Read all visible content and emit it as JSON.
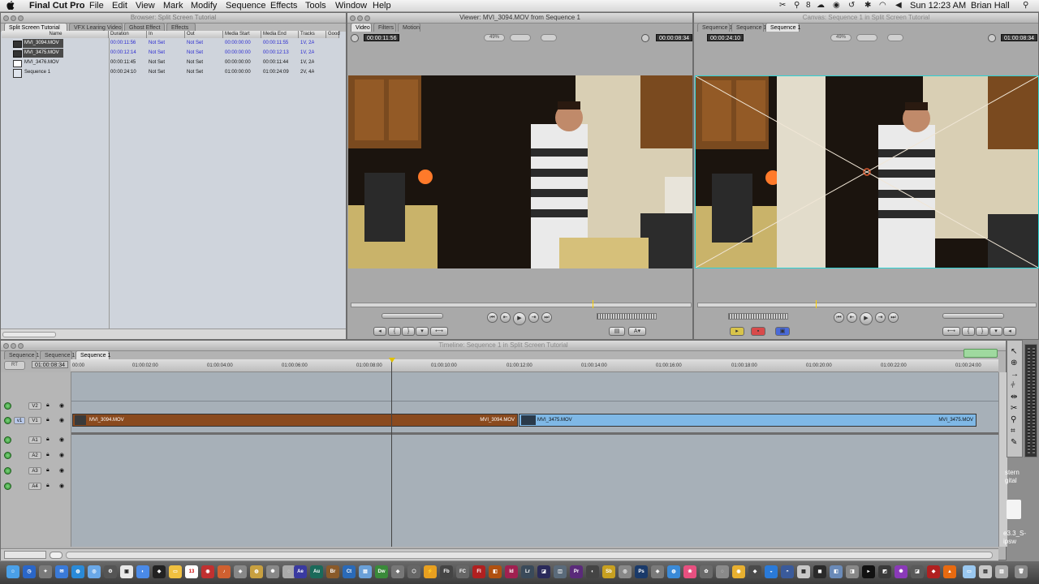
{
  "menubar": {
    "apple": "",
    "app_name": "Final Cut Pro",
    "items": [
      "File",
      "Edit",
      "View",
      "Mark",
      "Modify",
      "Sequence",
      "Effects",
      "Tools",
      "Window",
      "Help"
    ],
    "tray_badge": "8",
    "clock": "Sun 12:23 AM",
    "user": "Brian Hall"
  },
  "browser": {
    "title": "Browser: Split Screen Tutorial",
    "tabs": [
      "Split Screen Tutorial",
      "VFX Learing Video",
      "Ghost Effect",
      "Effects"
    ],
    "columns": [
      "Name",
      "Duration",
      "In",
      "Out",
      "Media Start",
      "Media End",
      "Tracks",
      "Good"
    ],
    "rows": [
      {
        "name": "MVI_3094.MOV",
        "duration": "00:00:11:56",
        "in": "Not Set",
        "out": "Not Set",
        "media_start": "00:00:00:00",
        "media_end": "00:00:11:55",
        "tracks": "1V, 2A"
      },
      {
        "name": "MVI_3475.MOV",
        "duration": "00:00:12:14",
        "in": "Not Set",
        "out": "Not Set",
        "media_start": "00:00:00:00",
        "media_end": "00:00:12:13",
        "tracks": "1V, 2A"
      },
      {
        "name": "MVI_3476.MOV",
        "duration": "00:00:11:45",
        "in": "Not Set",
        "out": "Not Set",
        "media_start": "00:00:00:00",
        "media_end": "00:00:11:44",
        "tracks": "1V, 2A"
      },
      {
        "name": "Sequence 1",
        "duration": "00:00:24:10",
        "in": "Not Set",
        "out": "Not Set",
        "media_start": "01:00:00:00",
        "media_end": "01:00:24:09",
        "tracks": "2V, 4A"
      }
    ]
  },
  "viewer": {
    "title": "Viewer: MVI_3094.MOV from Sequence 1",
    "tabs": [
      "Video",
      "Filters",
      "Motion"
    ],
    "timecode_left": "00:00:11:56",
    "zoom": "49%",
    "timecode_right": "00:00:08:34"
  },
  "canvas": {
    "title": "Canvas: Sequence 1 in Split Screen Tutorial",
    "tabs": [
      "Sequence 1",
      "Sequence 1",
      "Sequence 1"
    ],
    "timecode_left": "00:00:24:10",
    "zoom": "49%",
    "timecode_right": "01:00:08:34"
  },
  "timeline": {
    "title": "Timeline: Sequence 1 in Split Screen Tutorial",
    "tabs": [
      "Sequence 1",
      "Sequence 1",
      "Sequence 1"
    ],
    "rt_label": "RT",
    "current_timecode": "01:00:08:34",
    "ruler": [
      "00:00",
      "01:00:02:00",
      "01:00:04:00",
      "01:00:06:00",
      "01:00:08:00",
      "01:00:10:00",
      "01:00:12:00",
      "01:00:14:00",
      "01:00:16:00",
      "01:00:18:00",
      "01:00:20:00",
      "01:00:22:00",
      "01:00:24:00"
    ],
    "tracks": {
      "video": [
        "V2",
        "V1"
      ],
      "audio": [
        "A1",
        "A2",
        "A3",
        "A4"
      ],
      "source_patch": "v1"
    },
    "clips": [
      {
        "label_start": "MVI_3094.MOV",
        "label_end": "MVI_3094.MOV",
        "color": "#8a4a1e"
      },
      {
        "label_start": "MVI_3475.MOV",
        "label_end": "MVI_3475.MOV",
        "color": "#7fb8e6"
      }
    ]
  },
  "desktop": {
    "file_label_1": "stern",
    "file_label_2": "gital",
    "file_label_3": "e3.3_S-",
    "file_label_4": "ipsw"
  },
  "dock": {
    "icons": [
      "Finder",
      "Dashboard",
      "Safari",
      "Mail",
      "iChat",
      "Calendar",
      "Photos",
      "Music",
      "Preview",
      "After Effects",
      "Audition",
      "Bridge",
      "Capture",
      "Dreamweaver",
      "Flash",
      "Fireworks",
      "Illustrator",
      "InDesign",
      "Lightroom",
      "Premiere",
      "Soundbooth",
      "Photoshop",
      "Terminal",
      "Trash"
    ],
    "labels": [
      "Ae",
      "Au",
      "Br",
      "Ct",
      "Dw",
      "Fb",
      "FC",
      "Fl",
      "Id",
      "Lr",
      "Pr",
      "Sb",
      "Ps"
    ]
  }
}
